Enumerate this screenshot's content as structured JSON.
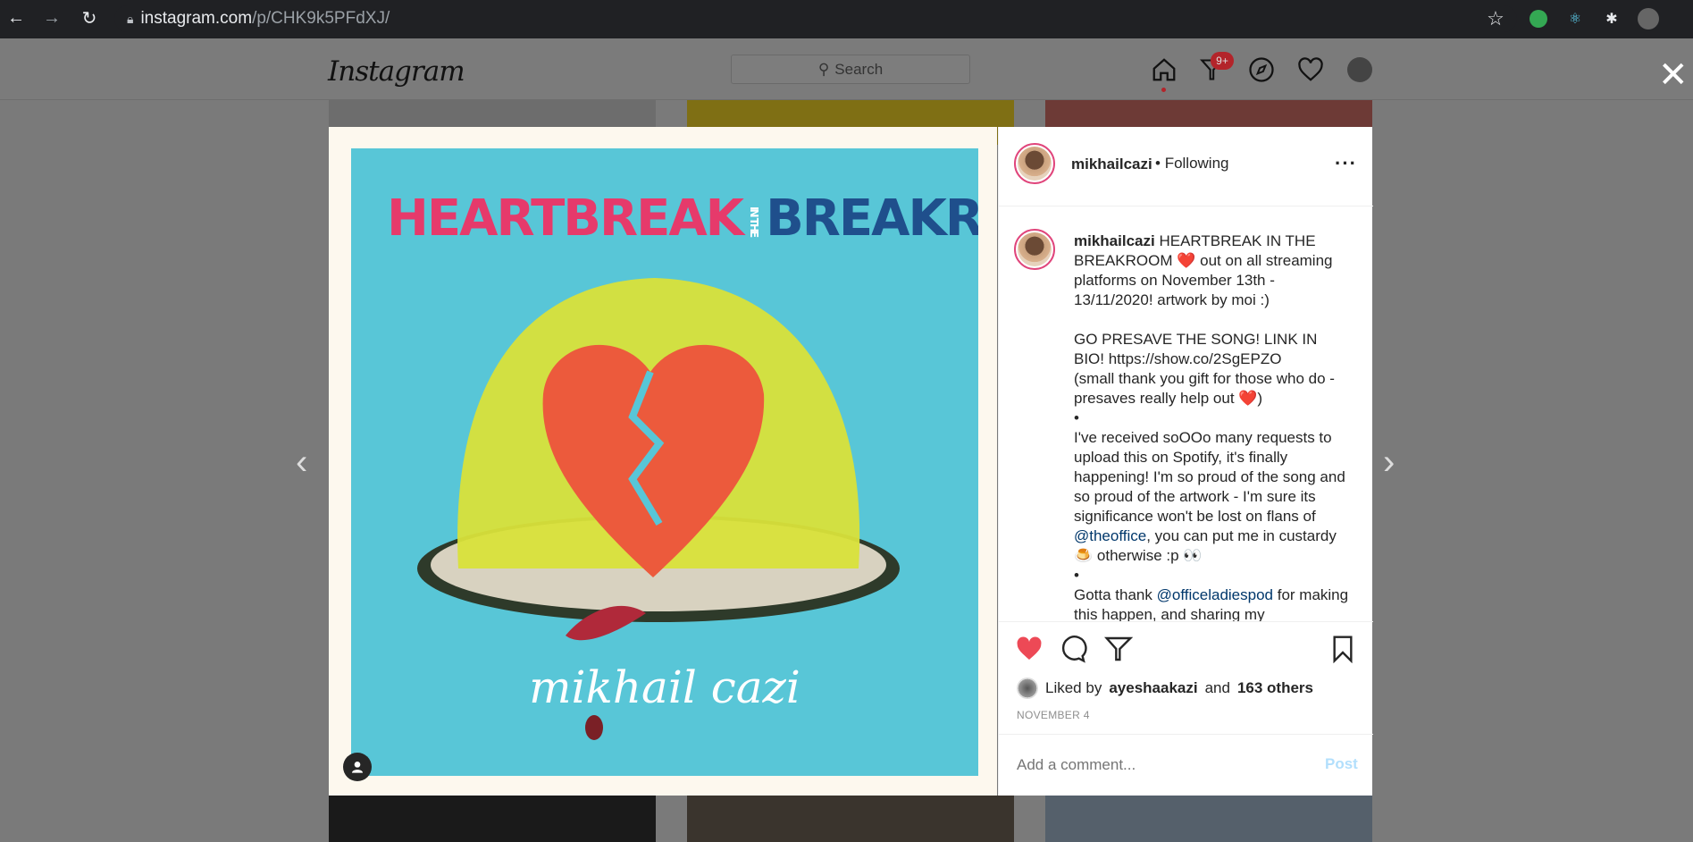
{
  "browser": {
    "url_host": "instagram.com",
    "url_path": "/p/CHK9k5PFdXJ/"
  },
  "header": {
    "logo": "Instagram",
    "search_placeholder": "Search",
    "notifications_badge": "9+"
  },
  "post": {
    "artwork": {
      "title_left": "HEARTBREAK",
      "title_mid": "IN THE",
      "title_right": "BREAKROOM",
      "signature": "mikhail cazi"
    },
    "author": "mikhailcazi",
    "follow_status": "Following",
    "caption_user": "mikhailcazi",
    "caption_lines": [
      "HEARTBREAK IN THE BREAKROOM ❤️ out on all streaming platforms on November 13th - 13/11/2020! artwork by moi :)",
      "",
      "GO PRESAVE THE SONG! LINK IN BIO! https://show.co/2SgEPZO",
      "(small thank you gift for those who do - presaves really help out ❤️)",
      "•",
      "I've received soOOo many requests to upload this on Spotify, it's finally happening! I'm so proud of the song and so proud of the artwork - I'm sure its significance won't be lost on flans of",
      "•",
      "Gotta thank"
    ],
    "mention_1": "@theoffice",
    "after_mention_1": ", you can put me in custardy 🍮 otherwise :p 👀",
    "mention_2": "@officeladiespod",
    "after_mention_2": " for making this happen, and sharing my",
    "liked_by_prefix": "Liked by",
    "liked_by_user": "ayeshaakazi",
    "liked_by_and": "and",
    "liked_by_others": "163 others",
    "date": "NOVEMBER 4",
    "comment_placeholder": "Add a comment...",
    "post_button": "Post"
  },
  "colors": {
    "like_red": "#ed4956",
    "art_bg": "#58c6d7",
    "title_pink": "#e63a6b",
    "title_blue": "#1f4f8c"
  }
}
